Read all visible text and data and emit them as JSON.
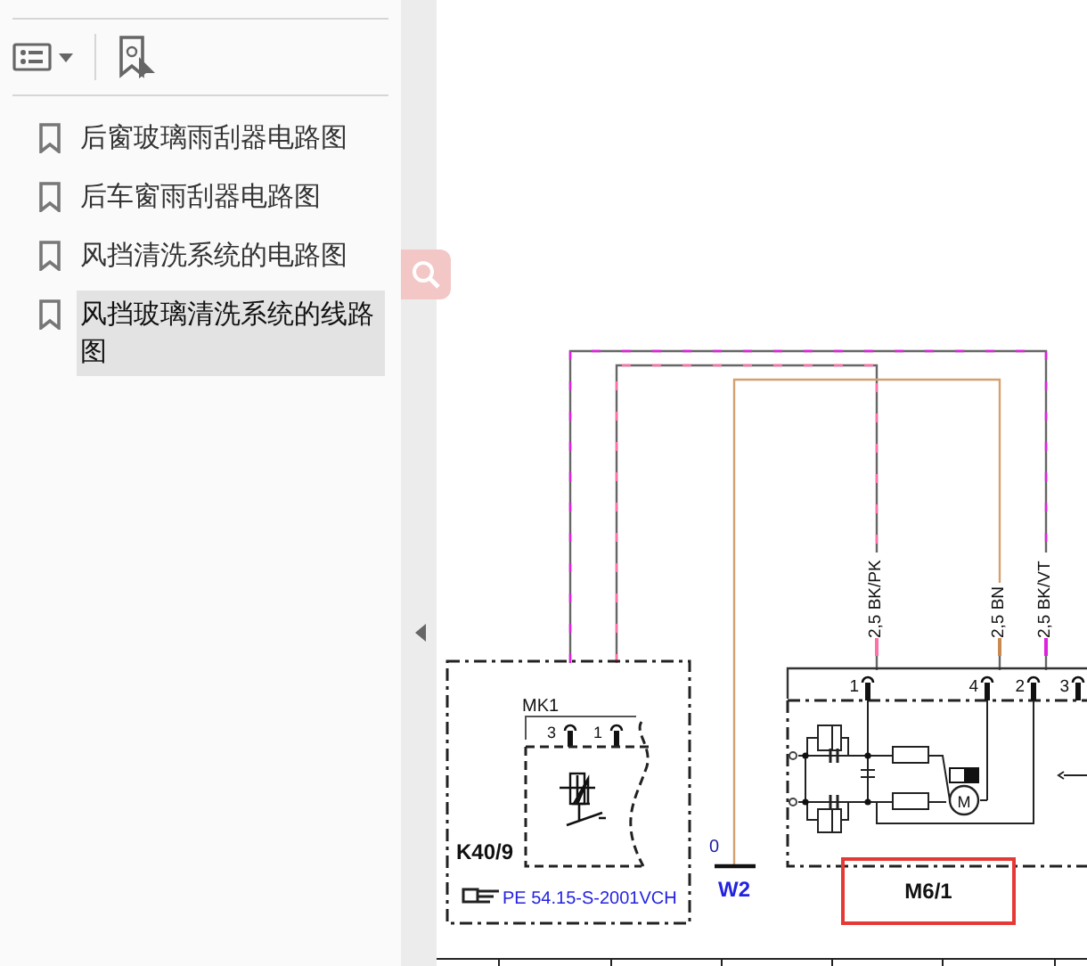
{
  "bookmarks": [
    {
      "label": "后窗玻璃雨刮器电路图",
      "selected": false
    },
    {
      "label": "后车窗雨刮器电路图",
      "selected": false
    },
    {
      "label": "风挡清洗系统的电路图",
      "selected": false
    },
    {
      "label": "风挡玻璃清洗系统的线路图",
      "selected": true
    }
  ],
  "diagram": {
    "wire_labels": [
      "2,5 BK/PK",
      "2,5 BN",
      "2,5 BK/VT"
    ],
    "m6_pins": [
      "1",
      "4",
      "2",
      "3"
    ],
    "k40_connector": "MK1",
    "k40_pins": [
      "3",
      "1"
    ],
    "k40_label": "K40/9",
    "reference": "PE 54.15-S-2001VCH",
    "ground_pin": "0",
    "ground_label": "W2",
    "m6_label": "M6/1",
    "motor_symbol": "M"
  }
}
